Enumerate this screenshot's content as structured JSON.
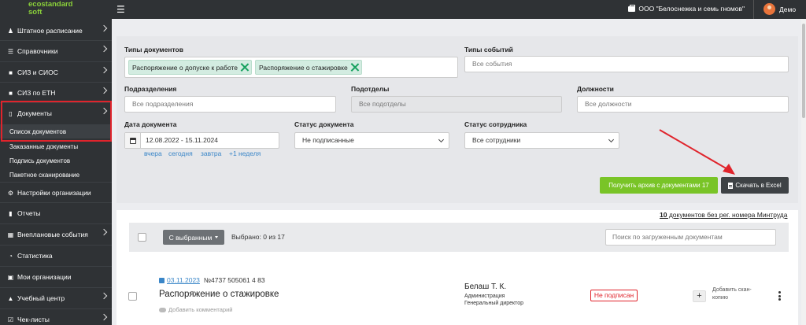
{
  "app": {
    "logo_line1": "ecostandard",
    "logo_line2": "soft",
    "org_name": "ООО \"Белоснежка и семь гномов\"",
    "user_name": "Демо"
  },
  "sidebar": {
    "items": [
      {
        "label": "Штатное расписание",
        "icon": "users-icon"
      },
      {
        "label": "Справочники",
        "icon": "list-icon"
      },
      {
        "label": "СИЗ и СИОС",
        "icon": "truck-icon"
      },
      {
        "label": "СИЗ по ЕТН",
        "icon": "truck-icon"
      },
      {
        "label": "Документы",
        "icon": "folder-icon"
      },
      {
        "label": "Настройки организации",
        "icon": "gear-icon"
      },
      {
        "label": "Отчеты",
        "icon": "clipboard-icon"
      },
      {
        "label": "Внеплановые события",
        "icon": "calendar-icon"
      },
      {
        "label": "Статистика",
        "icon": "pie-chart-icon"
      },
      {
        "label": "Мои организации",
        "icon": "briefcase-icon"
      },
      {
        "label": "Учебный центр",
        "icon": "graduation-cap-icon"
      },
      {
        "label": "Чек-листы",
        "icon": "checklist-icon"
      }
    ],
    "sub_items": [
      {
        "label": "Список документов",
        "active": true
      },
      {
        "label": "Заказанные документы",
        "active": false
      },
      {
        "label": "Подпись документов",
        "active": false
      },
      {
        "label": "Пакетное сканирование",
        "active": false
      }
    ]
  },
  "filters": {
    "doc_types": {
      "label": "Типы документов",
      "tags": [
        "Распоряжение о допуске к работе",
        "Распоряжение о стажировке"
      ]
    },
    "event_types": {
      "label": "Типы событий",
      "placeholder": "Все события"
    },
    "departments": {
      "label": "Подразделения",
      "placeholder": "Все подразделения"
    },
    "subdepartments": {
      "label": "Подотделы",
      "placeholder": "Все подотделы"
    },
    "positions": {
      "label": "Должности",
      "placeholder": "Все должности"
    },
    "doc_date": {
      "label": "Дата документа",
      "value": "12.08.2022 - 15.11.2024",
      "quick": [
        "вчера",
        "сегодня",
        "завтра",
        "+1 неделя"
      ]
    },
    "doc_status": {
      "label": "Статус документа",
      "value": "Не подписанные"
    },
    "employee_status": {
      "label": "Статус сотрудника",
      "value": "Все сотрудники"
    },
    "archive_button": "Получить архив с документами 17",
    "excel_button": "Скачать в Excel"
  },
  "list": {
    "no_reg_count": "10",
    "no_reg_text": " документов без рег. номера Минтруда",
    "with_selected": "С выбранным",
    "selected_text": "Выбрано: 0 из 17",
    "search_placeholder": "Поиск по загруженным документам",
    "documents": [
      {
        "date": "03.11.2023",
        "number": "№4737 505061 4 83",
        "title": "Распоряжение о стажировке",
        "comment": "Добавить комментарий",
        "person": "Белаш Т. К.",
        "department": "Администрация",
        "position": "Генеральный директор",
        "status": "Не подписан",
        "scan_label": "Добавить скан-копию"
      }
    ]
  },
  "colors": {
    "sidebar_bg": "#2f3235",
    "highlight_red": "#e0242c",
    "green_button": "#79c427",
    "link_blue": "#3a86c8",
    "tag_bg": "#d3ece1"
  }
}
